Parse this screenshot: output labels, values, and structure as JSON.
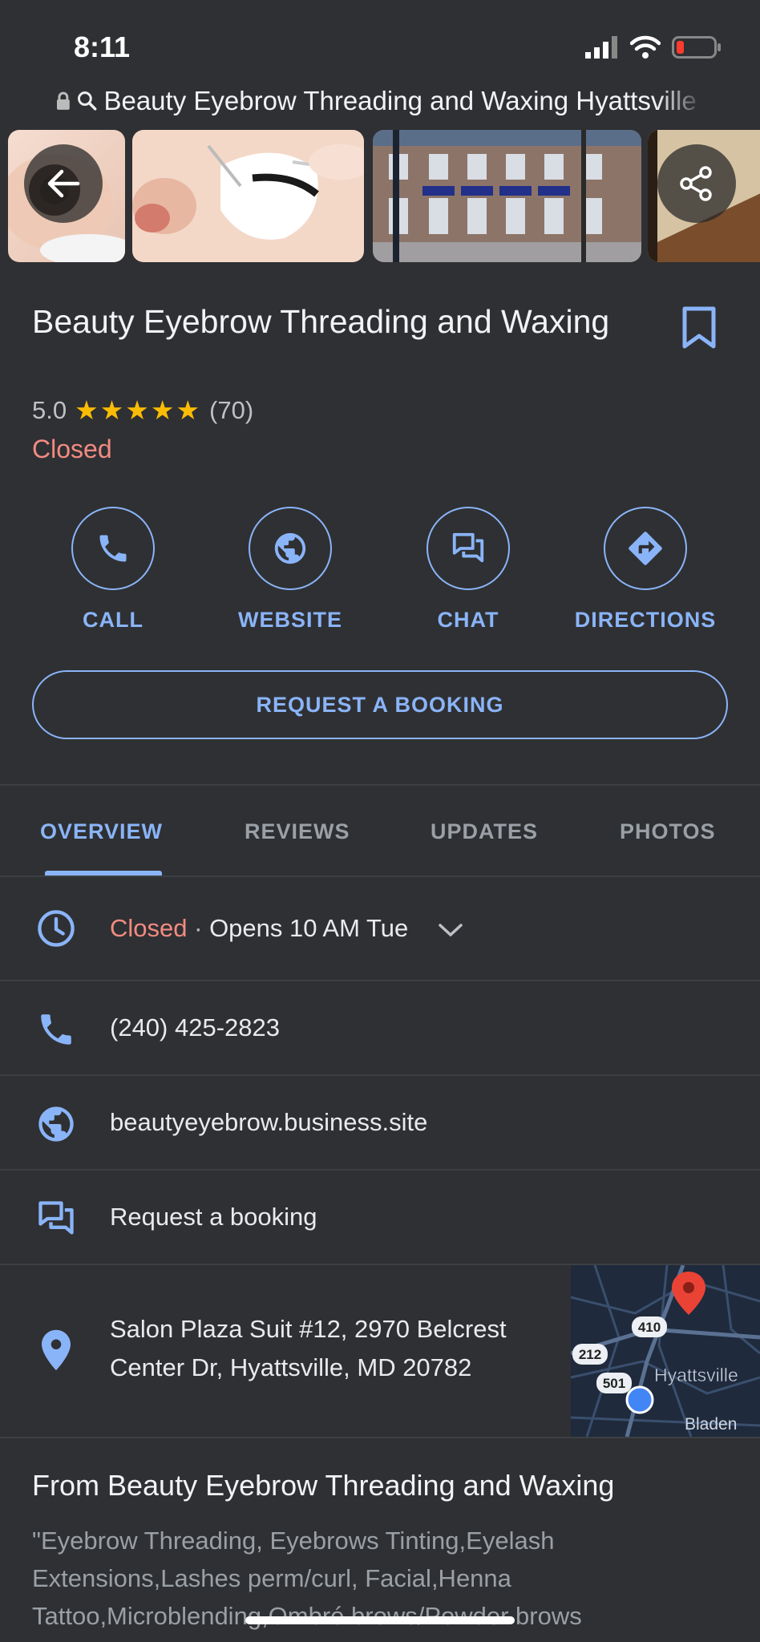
{
  "status_bar": {
    "time": "8:11"
  },
  "browser": {
    "url_text": "Beauty Eyebrow Threading and Waxing Hyattsville"
  },
  "business": {
    "name": "Beauty Eyebrow Threading and Waxing",
    "rating": "5.0",
    "stars": "★★★★★",
    "review_count": "(70)",
    "status": "Closed"
  },
  "actions": [
    {
      "label": "CALL",
      "icon": "phone-icon"
    },
    {
      "label": "WEBSITE",
      "icon": "globe-icon"
    },
    {
      "label": "CHAT",
      "icon": "chat-icon"
    },
    {
      "label": "DIRECTIONS",
      "icon": "directions-icon"
    }
  ],
  "booking_button": "REQUEST A BOOKING",
  "tabs": [
    {
      "label": "OVERVIEW",
      "active": true
    },
    {
      "label": "REVIEWS"
    },
    {
      "label": "UPDATES"
    },
    {
      "label": "PHOTOS"
    }
  ],
  "info": {
    "hours_status": "Closed",
    "hours_separator": " · ",
    "hours_detail": "Opens 10 AM Tue",
    "phone": "(240) 425-2823",
    "website": "beautyeyebrow.business.site",
    "booking": "Request a booking",
    "address_line1": "Salon Plaza Suit #12, 2970 Belcrest",
    "address_line2": "Center Dr, Hyattsville, MD 20782"
  },
  "map": {
    "route_1": "212",
    "route_2": "410",
    "route_3": "501",
    "city": "Hyattsville",
    "city2": "Bladen"
  },
  "from_section": {
    "title": "From Beauty Eyebrow Threading and Waxing",
    "description": "\"Eyebrow Threading, Eyebrows Tinting,Eyelash Extensions,Lashes perm/curl, Facial,Henna Tattoo,Microblending,Ombré brows/Powder brows"
  },
  "colors": {
    "accent": "#8ab4f8",
    "closed": "#f28b82",
    "star": "#fbbc04",
    "background": "#2f3033"
  }
}
